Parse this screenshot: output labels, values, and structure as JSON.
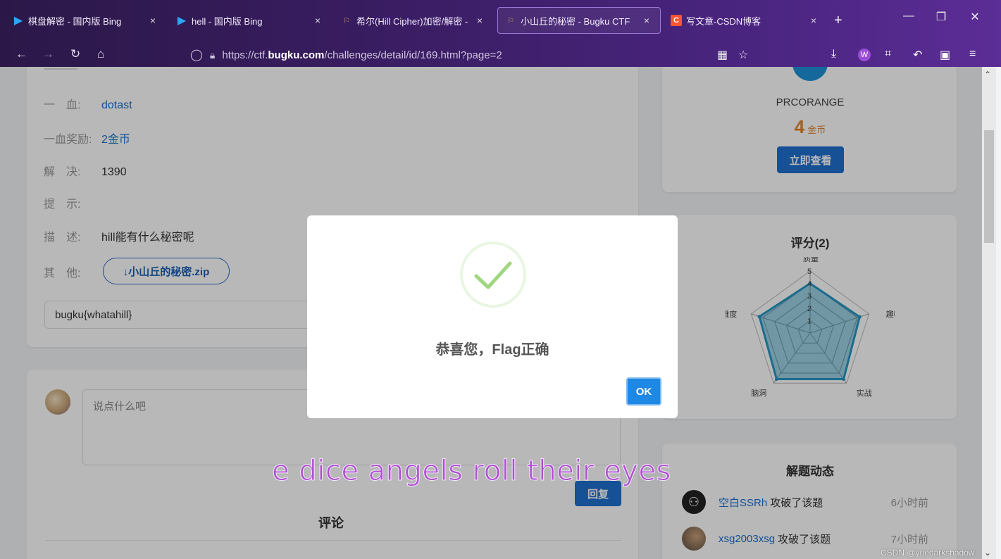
{
  "browser": {
    "tabs": [
      {
        "title": "棋盘解密 - 国内版 Bing",
        "favicon": "bing-icon"
      },
      {
        "title": "hell - 国内版 Bing",
        "favicon": "bing-icon"
      },
      {
        "title": "希尔(Hill Cipher)加密/解密 - ",
        "favicon": "flag-icon"
      },
      {
        "title": "小山丘的秘密 - Bugku CTF",
        "favicon": "flag-icon",
        "active": true
      },
      {
        "title": "写文章-CSDN博客",
        "favicon": "csdn-icon"
      }
    ],
    "url_prefix": "https://ctf.",
    "url_domain": "bugku.com",
    "url_path": "/challenges/detail/id/169.html?page=2"
  },
  "challenge": {
    "first_blood_label": "一　血:",
    "first_blood_value": "dotast",
    "reward_label": "一血奖励:",
    "reward_value": "2金币",
    "solved_label": "解　决:",
    "solved_value": "1390",
    "hint_label": "提　示:",
    "hint_value": "",
    "desc_label": "描　述:",
    "desc_value": "hill能有什么秘密呢",
    "other_label": "其　他:",
    "download_label": "↓小山丘的秘密.zip",
    "flag_input_value": "bugku{whatahill}"
  },
  "comment": {
    "placeholder": "说点什么吧",
    "reply_label": "回复",
    "comments_title": "评论"
  },
  "profile": {
    "name": "PRCORANGE",
    "coins": "4",
    "coins_unit": "金币",
    "view_label": "立即查看"
  },
  "rating": {
    "title": "评分(2)",
    "axes": [
      "质量",
      "趣味",
      "实战",
      "脑洞",
      "难度"
    ],
    "ticks": [
      "1",
      "2",
      "3",
      "4",
      "5"
    ]
  },
  "chart_data": {
    "type": "radar",
    "categories": [
      "质量",
      "趣味",
      "实战",
      "脑洞",
      "难度"
    ],
    "values": [
      4,
      4.2,
      4.6,
      4.6,
      4.3
    ],
    "ylim": [
      0,
      5
    ],
    "ticks": [
      1,
      2,
      3,
      4,
      5
    ],
    "color": "#2596c4"
  },
  "solves": {
    "title": "解题动态",
    "rows": [
      {
        "user": "空白SSRh",
        "action": "攻破了该题",
        "time": "6小时前"
      },
      {
        "user": "xsg2003xsg",
        "action": "攻破了该题",
        "time": "7小时前"
      }
    ]
  },
  "modal": {
    "message": "恭喜您，Flag正确",
    "ok_label": "OK"
  },
  "overlay_lyric": "e dice angels roll their eyes",
  "watermark": "CSDN @yuedarkshadow"
}
